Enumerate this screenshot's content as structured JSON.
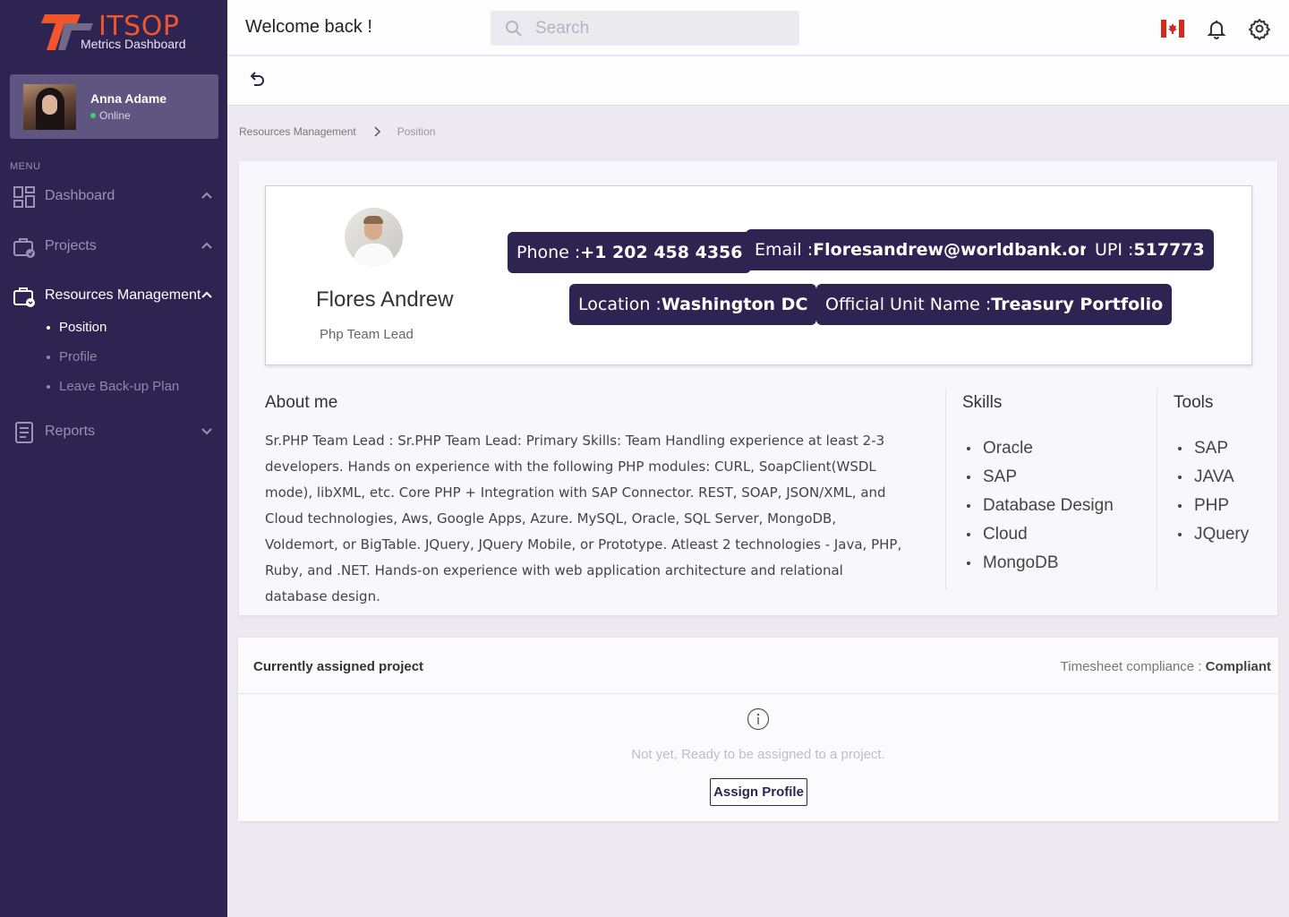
{
  "brand": {
    "title": "ITSOP",
    "subtitle": "Metrics Dashboard",
    "accent": "#f0552c",
    "sidebar_bg": "#2e2452"
  },
  "user": {
    "name": "Anna Adame",
    "status": "Online"
  },
  "menu": {
    "label": "MENU",
    "items": [
      {
        "label": "Dashboard",
        "icon": "dashboard-icon"
      },
      {
        "label": "Projects",
        "icon": "projects-icon"
      },
      {
        "label": "Resources Management",
        "icon": "resources-icon"
      },
      {
        "label": "Reports",
        "icon": "reports-icon"
      }
    ],
    "sub_items": [
      "Position",
      "Profile",
      "Leave Back-up Plan"
    ]
  },
  "header": {
    "welcome": "Welcome back !",
    "search_placeholder": "Search"
  },
  "breadcrumb": {
    "parent": "Resources Management",
    "current": "Position"
  },
  "profile": {
    "name": "Flores Andrew",
    "role": "Php Team Lead",
    "phone_label": "Phone : ",
    "phone": "+1 202 458 4356",
    "email_label": "Email : ",
    "email": "Floresandrew@worldbank.org",
    "upi_label": "UPI : ",
    "upi": "517773",
    "location_label": "Location : ",
    "location": "Washington DC",
    "unit_label": "Official Unit Name : ",
    "unit": "Treasury Portfolio"
  },
  "about": {
    "title": "About me",
    "text": "Sr.PHP Team Lead : Sr.PHP Team Lead: Primary Skills: Team Handling experience at least 2-3 developers. Hands on experience with the following PHP modules: CURL, SoapClient(WSDL mode), libXML, etc. Core PHP + Integration with SAP Connector. REST, SOAP, JSON/XML, and Cloud technologies, Aws, Google Apps, Azure. MySQL, Oracle, SQL Server, MongoDB, Voldemort, or BigTable. JQuery, JQuery Mobile, or  Prototype. Atleast 2 technologies - Java, PHP, Ruby, and .NET. Hands-on experience with web application architecture and relational database design."
  },
  "skills": {
    "title": "Skills",
    "items": [
      "Oracle",
      "SAP",
      "Database Design",
      "Cloud",
      "MongoDB"
    ]
  },
  "tools": {
    "title": "Tools",
    "items": [
      "SAP",
      "JAVA",
      "PHP",
      "JQuery"
    ]
  },
  "project": {
    "title": "Currently assigned project",
    "compliance_label": "Timesheet compliance : ",
    "compliance_value": "Compliant",
    "empty_message": "Not yet, Ready to be assigned to a project.",
    "assign_label": "Assign Profile"
  }
}
